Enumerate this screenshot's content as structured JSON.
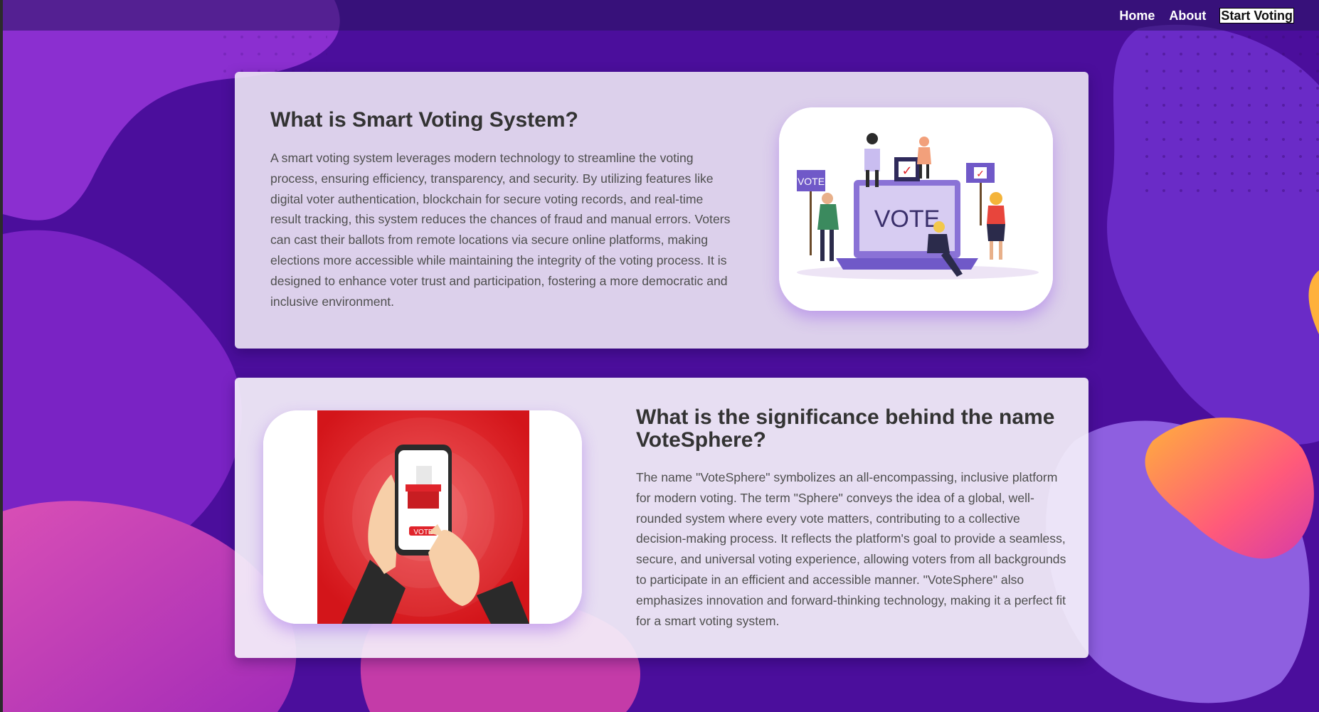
{
  "nav": {
    "links": [
      "Home",
      "About",
      "Start Voting"
    ]
  },
  "section1": {
    "title": "What is Smart Voting System?",
    "body": "A smart voting system leverages modern technology to streamline the voting process, ensuring efficiency, transparency, and security. By utilizing features like digital voter authentication, blockchain for secure voting records, and real-time result tracking, this system reduces the chances of fraud and manual errors. Voters can cast their ballots from remote locations via secure online platforms, making elections more accessible while maintaining the integrity of the voting process. It is designed to enhance voter trust and participation, fostering a more democratic and inclusive environment.",
    "image": {
      "laptop_text": "VOTE",
      "sign_text": "VOTE",
      "checkmark": "✓"
    }
  },
  "section2": {
    "title": "What is the significance behind the name VoteSphere?",
    "body": "The name \"VoteSphere\" symbolizes an all-encompassing, inclusive platform for modern voting. The term \"Sphere\" conveys the idea of a global, well-rounded system where every vote matters, contributing to a collective decision-making process. It reflects the platform's goal to provide a seamless, secure, and universal voting experience, allowing voters from all backgrounds to participate in an efficient and accessible manner. \"VoteSphere\" also emphasizes innovation and forward-thinking technology, making it a perfect fit for a smart voting system.",
    "image": {
      "phone_button_text": "VOTE"
    }
  },
  "colors": {
    "background": "#4a0f9a",
    "accent_purple": "#8a63d2",
    "accent_red": "#e8191c",
    "text_dark": "#333333",
    "text_body": "#4f4f4f"
  }
}
